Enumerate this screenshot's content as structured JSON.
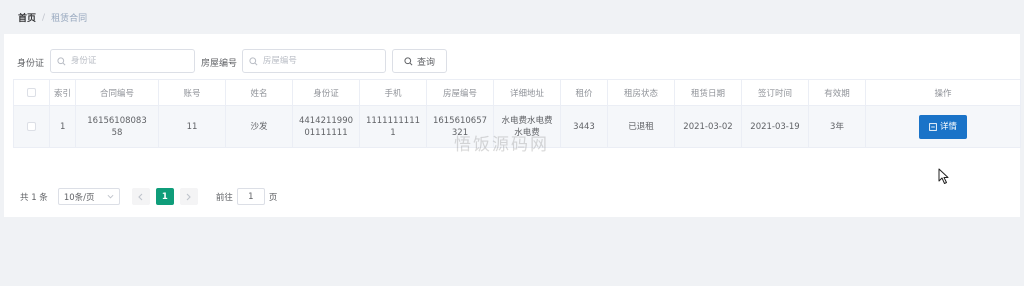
{
  "breadcrumb": {
    "home": "首页",
    "separator": "/",
    "current": "租赁合同"
  },
  "search": {
    "id_label": "身份证",
    "id_placeholder": "身份证",
    "house_label": "房屋编号",
    "house_placeholder": "房屋编号",
    "query_label": "查询"
  },
  "table": {
    "headers": [
      "索引",
      "合同编号",
      "账号",
      "姓名",
      "身份证",
      "手机",
      "房屋编号",
      "详细地址",
      "租价",
      "租房状态",
      "租赁日期",
      "签订时间",
      "有效期",
      "操作"
    ],
    "rows": [
      {
        "index": "1",
        "contract_no": [
          "16156108083",
          "58"
        ],
        "account": "11",
        "name": "沙发",
        "id_card": [
          "4414211990",
          "01111111"
        ],
        "phone": [
          "1111111111",
          "1"
        ],
        "house_no": [
          "1615610657",
          "321"
        ],
        "address": [
          "水电费水电费",
          "水电费"
        ],
        "price": "3443",
        "status": "已退租",
        "lease_date": "2021-03-02",
        "sign_time": "2021-03-19",
        "validity": "3年",
        "action": "详情"
      }
    ]
  },
  "pagination": {
    "total": "共 1 条",
    "page_size": "10条/页",
    "current_page": "1",
    "goto_label": "前往",
    "goto_value": "1",
    "page_suffix": "页"
  },
  "watermark": "悟饭源码网",
  "colors": {
    "primary": "#1a73c8",
    "active_page": "#0f9d7a",
    "background": "#f0f2f5"
  }
}
